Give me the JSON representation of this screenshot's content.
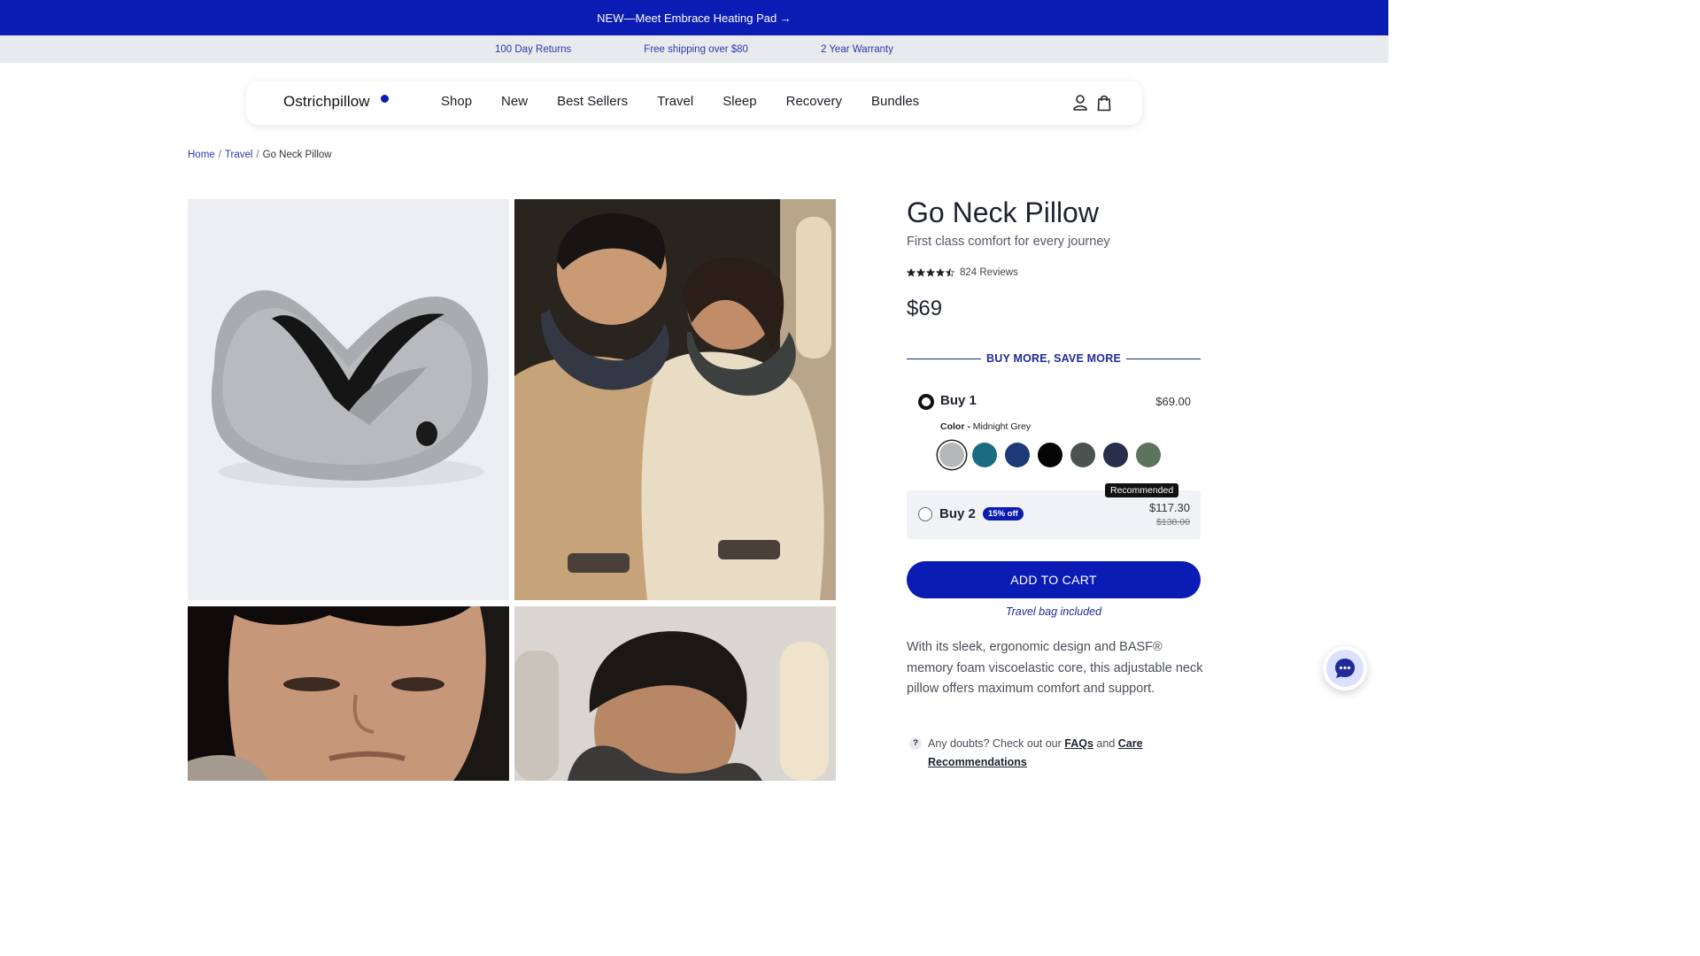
{
  "announcement": {
    "text": "NEW—Meet Embrace Heating Pad →"
  },
  "perks": [
    "100 Day Returns",
    "Free shipping over $80",
    "2 Year Warranty"
  ],
  "nav": {
    "logo": "Ostrichpillow",
    "links": [
      "Shop",
      "New",
      "Best Sellers",
      "Travel",
      "Sleep",
      "Recovery",
      "Bundles"
    ],
    "icons": [
      "account-icon",
      "bag-icon"
    ]
  },
  "breadcrumb": {
    "home": "Home",
    "travel": "Travel",
    "current": "Go Neck Pillow",
    "separator": "/"
  },
  "product": {
    "title": "Go Neck Pillow",
    "subtitle": "First class comfort for every journey",
    "rating": 4.5,
    "reviews": "824 Reviews",
    "price": "$69"
  },
  "bundle": {
    "heading": "BUY MORE, SAVE MORE",
    "option1": {
      "label": "Buy 1",
      "price": "$69.00",
      "color_label": "Color -",
      "color_value": "Midnight Grey",
      "swatches": [
        "#b7b8ba",
        "#1b6b80",
        "#1d3a78",
        "#050505",
        "#4b5350",
        "#26304c",
        "#5d745c"
      ]
    },
    "option2": {
      "label": "Buy 2",
      "badge": "15% off",
      "recommended": "Recommended",
      "price": "$117.30",
      "old_price": "$138.00"
    }
  },
  "cta": {
    "add_to_cart": "ADD TO CART",
    "note": "Travel bag included"
  },
  "description": "With its sleek, ergonomic design and BASF® memory foam viscoelastic core, this adjustable neck pillow offers maximum comfort and support.",
  "help": {
    "icon": "?",
    "prefix": "Any doubts? Check out our",
    "faqs": "FAQs",
    "and": "and",
    "care": "Care Recommendations"
  },
  "colors": {
    "brand": "#0b1cb4",
    "perks_bg": "#e8eaee",
    "link": "#2b3aa8"
  }
}
